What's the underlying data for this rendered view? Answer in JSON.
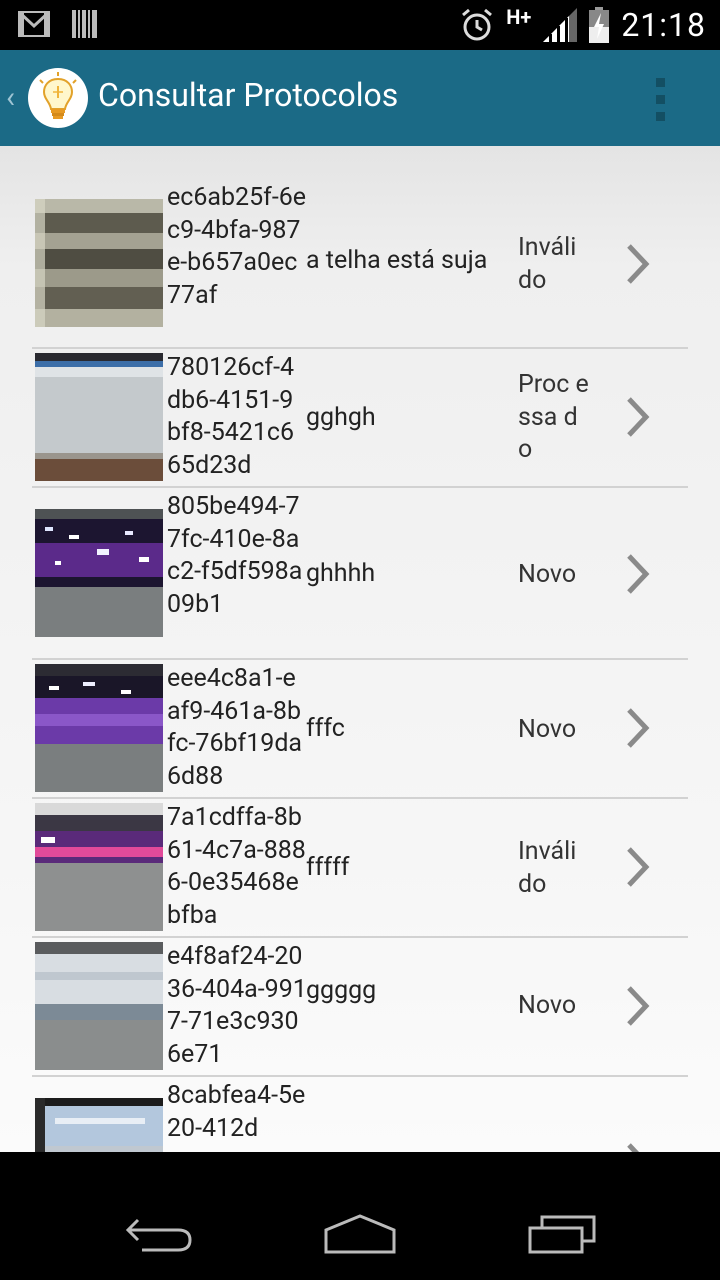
{
  "app": {
    "title": "Consultar Protocolos",
    "accent_color": "#1b6a86",
    "logo_icon": "lightbulb-icon"
  },
  "status_bar": {
    "time": "21:18",
    "network": "H+",
    "icons": [
      "gmail-icon",
      "barcode-icon",
      "alarm-icon",
      "signal-icon",
      "battery-charging-icon"
    ]
  },
  "protocols": [
    {
      "code": "ec6ab25f-6ec9-4bfa-987e-b657a0ec77af",
      "description": "a telha está suja",
      "status": "Inváli do",
      "thumbnail": "roof-tile-photo"
    },
    {
      "code": "780126cf-4db6-4151-9bf8-5421c665d23d",
      "description": "gghgh",
      "status": "Proc essa do",
      "thumbnail": "screen-photo"
    },
    {
      "code": "805be494-77fc-410e-8ac2-f5df598a09b1",
      "description": "ghhhh",
      "status": "Novo",
      "thumbnail": "screen-photo"
    },
    {
      "code": "eee4c8a1-eaf9-461a-8bfc-76bf19da6d88",
      "description": "fffc",
      "status": "Novo",
      "thumbnail": "screen-photo"
    },
    {
      "code": "7a1cdffa-8b61-4c7a-8886-0e35468ebfba",
      "description": "fffff",
      "status": "Inváli do",
      "thumbnail": "screen-photo"
    },
    {
      "code": "e4f8af24-2036-404a-9917-71e3c9306e71",
      "description": "ggggg",
      "status": "Novo",
      "thumbnail": "screen-photo"
    },
    {
      "code": "8cabfea4-5e20-412d",
      "description": "",
      "status": "",
      "thumbnail": "screen-photo"
    }
  ],
  "nav_bar": {
    "buttons": [
      "back-icon",
      "home-icon",
      "recent-apps-icon"
    ]
  }
}
